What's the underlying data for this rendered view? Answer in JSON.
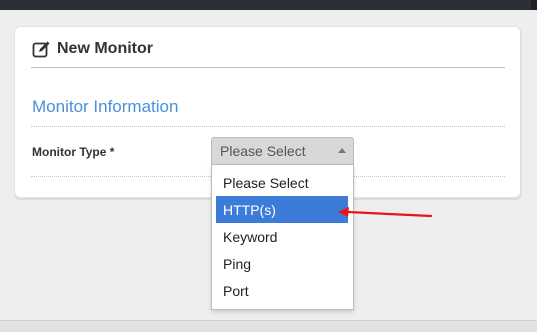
{
  "panel": {
    "title": "New Monitor",
    "title_icon": "edit-icon"
  },
  "section": {
    "heading": "Monitor Information"
  },
  "form": {
    "monitor_type_label": "Monitor Type *",
    "monitor_type_value": "Please Select",
    "options": [
      "Please Select",
      "HTTP(s)",
      "Keyword",
      "Ping",
      "Port"
    ],
    "highlighted_option": "HTTP(s)"
  },
  "colors": {
    "accent_blue": "#4a90d9",
    "selected_option": "#3d7bd9",
    "annotation_arrow": "#e8141c"
  }
}
